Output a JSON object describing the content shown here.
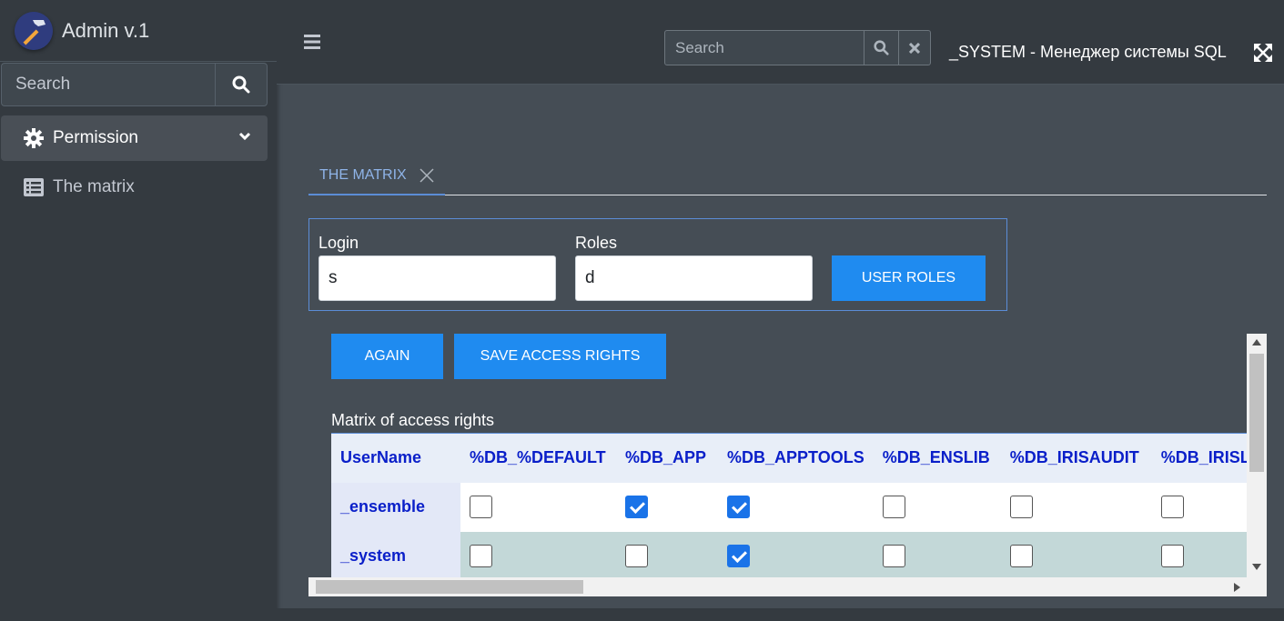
{
  "brand": {
    "title": "Admin v.1"
  },
  "sidebar": {
    "search_placeholder": "Search",
    "items": [
      {
        "label": "Permission",
        "icon": "gear-icon",
        "active": true
      },
      {
        "label": "The matrix",
        "icon": "list-icon"
      }
    ]
  },
  "header": {
    "search_placeholder": "Search",
    "title": "_SYSTEM - Менеджер системы SQL"
  },
  "tabs": [
    {
      "label": "THE MATRIX"
    }
  ],
  "form": {
    "login_label": "Login",
    "login_value": "s",
    "roles_label": "Roles",
    "roles_value": "d",
    "user_roles_button": "USER ROLES"
  },
  "actions": {
    "again_button": "AGAIN",
    "save_button": "SAVE ACCESS RIGHTS"
  },
  "matrix": {
    "caption": "Matrix of access rights",
    "columns": [
      "UserName",
      "%DB_%DEFAULT",
      "%DB_APP",
      "%DB_APPTOOLS",
      "%DB_ENSLIB",
      "%DB_IRISAUDIT",
      "%DB_IRISL"
    ],
    "rows": [
      {
        "name": "_ensemble",
        "checks": [
          false,
          true,
          true,
          false,
          false,
          false
        ]
      },
      {
        "name": "_system",
        "checks": [
          false,
          false,
          true,
          false,
          false,
          false
        ]
      }
    ]
  },
  "colors": {
    "accent": "#1f8bf0",
    "header_text": "#0a1fc9",
    "sidebar_bg": "#343a40",
    "content_bg": "#454d55"
  }
}
